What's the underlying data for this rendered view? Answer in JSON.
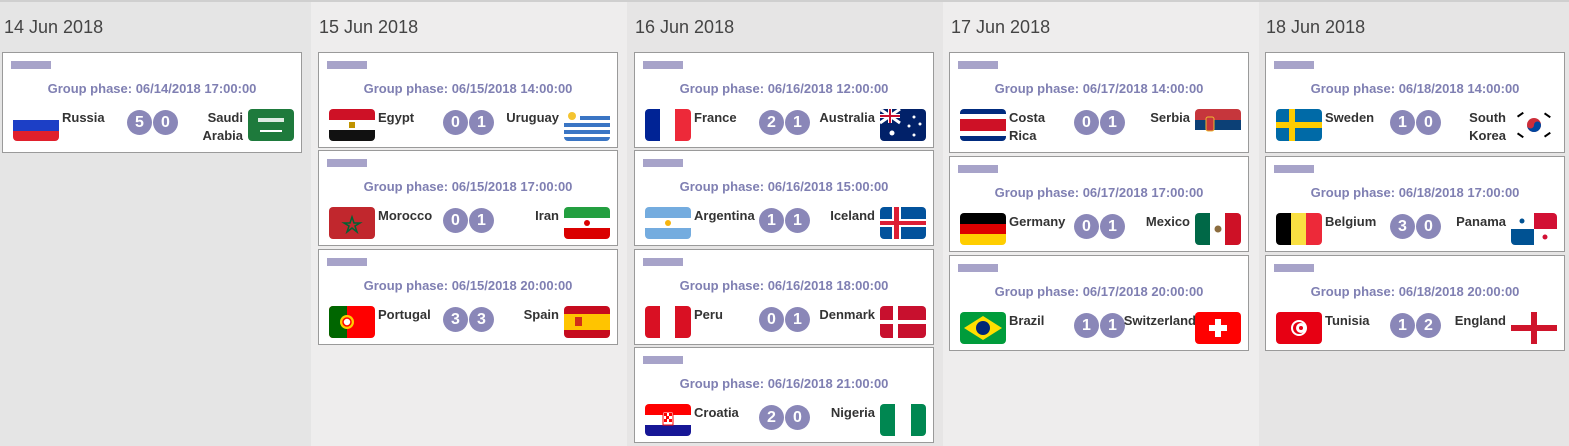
{
  "days": [
    {
      "date": "14 Jun 2018",
      "matches": [
        {
          "phase": "Group phase: 06/14/2018 17:00:00",
          "home": "Russia",
          "away": "Saudi Arabia",
          "home_score": "5",
          "away_score": "0",
          "home_flag": "russia-flag",
          "away_flag": "saudi-arabia-flag"
        }
      ]
    },
    {
      "date": "15 Jun 2018",
      "matches": [
        {
          "phase": "Group phase: 06/15/2018 14:00:00",
          "home": "Egypt",
          "away": "Uruguay",
          "home_score": "0",
          "away_score": "1",
          "home_flag": "egypt-flag",
          "away_flag": "uruguay-flag"
        },
        {
          "phase": "Group phase: 06/15/2018 17:00:00",
          "home": "Morocco",
          "away": "Iran",
          "home_score": "0",
          "away_score": "1",
          "home_flag": "morocco-flag",
          "away_flag": "iran-flag"
        },
        {
          "phase": "Group phase: 06/15/2018 20:00:00",
          "home": "Portugal",
          "away": "Spain",
          "home_score": "3",
          "away_score": "3",
          "home_flag": "portugal-flag",
          "away_flag": "spain-flag"
        }
      ]
    },
    {
      "date": "16 Jun 2018",
      "matches": [
        {
          "phase": "Group phase: 06/16/2018 12:00:00",
          "home": "France",
          "away": "Australia",
          "home_score": "2",
          "away_score": "1",
          "home_flag": "france-flag",
          "away_flag": "australia-flag"
        },
        {
          "phase": "Group phase: 06/16/2018 15:00:00",
          "home": "Argentina",
          "away": "Iceland",
          "home_score": "1",
          "away_score": "1",
          "home_flag": "argentina-flag",
          "away_flag": "iceland-flag"
        },
        {
          "phase": "Group phase: 06/16/2018 18:00:00",
          "home": "Peru",
          "away": "Denmark",
          "home_score": "0",
          "away_score": "1",
          "home_flag": "peru-flag",
          "away_flag": "denmark-flag"
        },
        {
          "phase": "Group phase: 06/16/2018 21:00:00",
          "home": "Croatia",
          "away": "Nigeria",
          "home_score": "2",
          "away_score": "0",
          "home_flag": "croatia-flag",
          "away_flag": "nigeria-flag"
        }
      ]
    },
    {
      "date": "17 Jun 2018",
      "matches": [
        {
          "phase": "Group phase: 06/17/2018 14:00:00",
          "home": "Costa Rica",
          "away": "Serbia",
          "home_score": "0",
          "away_score": "1",
          "home_flag": "costa-rica-flag",
          "away_flag": "serbia-flag"
        },
        {
          "phase": "Group phase: 06/17/2018 17:00:00",
          "home": "Germany",
          "away": "Mexico",
          "home_score": "0",
          "away_score": "1",
          "home_flag": "germany-flag",
          "away_flag": "mexico-flag"
        },
        {
          "phase": "Group phase: 06/17/2018 20:00:00",
          "home": "Brazil",
          "away": "Switzerland",
          "home_score": "1",
          "away_score": "1",
          "home_flag": "brazil-flag",
          "away_flag": "switzerland-flag"
        }
      ]
    },
    {
      "date": "18 Jun 2018",
      "matches": [
        {
          "phase": "Group phase: 06/18/2018 14:00:00",
          "home": "Sweden",
          "away": "South Korea",
          "home_score": "1",
          "away_score": "0",
          "home_flag": "sweden-flag",
          "away_flag": "south-korea-flag"
        },
        {
          "phase": "Group phase: 06/18/2018 17:00:00",
          "home": "Belgium",
          "away": "Panama",
          "home_score": "3",
          "away_score": "0",
          "home_flag": "belgium-flag",
          "away_flag": "panama-flag"
        },
        {
          "phase": "Group phase: 06/18/2018 20:00:00",
          "home": "Tunisia",
          "away": "England",
          "home_score": "1",
          "away_score": "2",
          "home_flag": "tunisia-flag",
          "away_flag": "england-flag"
        }
      ]
    }
  ],
  "colors": {
    "score_badge": "#8a87b8",
    "phase_text": "#7f7fb2",
    "phase_bar": "#a7a3c9"
  }
}
